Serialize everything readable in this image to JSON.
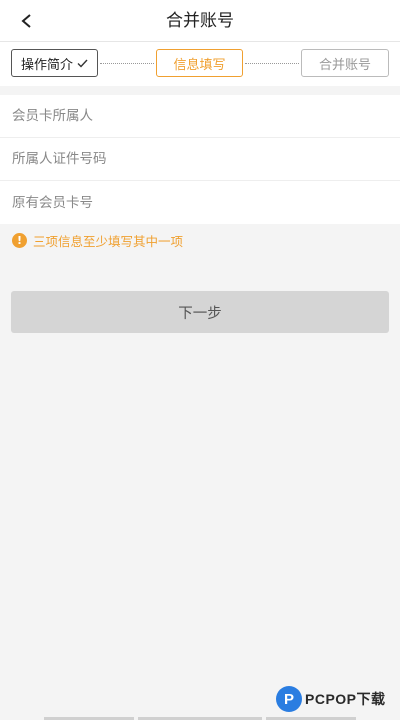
{
  "header": {
    "title": "合并账号",
    "back_icon": "chevron-left-icon"
  },
  "steps": [
    {
      "label": "操作简介",
      "state": "done"
    },
    {
      "label": "信息填写",
      "state": "active"
    },
    {
      "label": "合并账号",
      "state": "pending"
    }
  ],
  "form": {
    "fields": [
      {
        "placeholder": "会员卡所属人",
        "value": ""
      },
      {
        "placeholder": "所属人证件号码",
        "value": ""
      },
      {
        "placeholder": "原有会员卡号",
        "value": ""
      }
    ]
  },
  "notice": {
    "icon": "!",
    "text": "三项信息至少填写其中一项"
  },
  "next_button": {
    "label": "下一步"
  },
  "watermark": {
    "logo": "P",
    "text": "PCPOP下载"
  },
  "colors": {
    "accent": "#f0a030",
    "button_disabled": "#d5d5d5",
    "background": "#f4f4f4"
  }
}
